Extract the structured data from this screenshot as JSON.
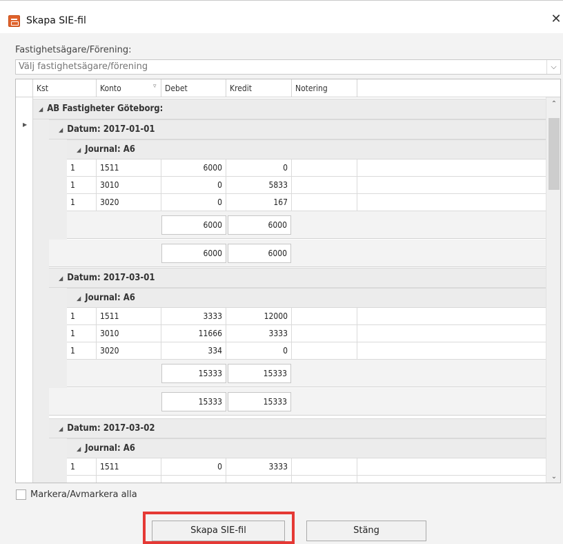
{
  "window": {
    "title": "Skapa SIE-fil",
    "close_glyph": "✕"
  },
  "owner": {
    "label": "Fastighetsägare/Förening:",
    "placeholder": "Välj fastighetsägare/förening",
    "dropdown_glyph": "⌵"
  },
  "grid": {
    "columns": [
      "Kst",
      "Konto",
      "Debet",
      "Kredit",
      "Notering"
    ],
    "group": "AB Fastigheter Göteborg:",
    "dates": [
      {
        "label": "Datum: 2017-01-01",
        "journal": "Journal: A6",
        "rows": [
          [
            "1",
            "1511",
            "6000",
            "0",
            ""
          ],
          [
            "1",
            "3010",
            "0",
            "5833",
            ""
          ],
          [
            "1",
            "3020",
            "0",
            "167",
            ""
          ]
        ],
        "journal_sum": [
          "6000",
          "6000"
        ],
        "date_sum": [
          "6000",
          "6000"
        ]
      },
      {
        "label": "Datum: 2017-03-01",
        "journal": "Journal: A6",
        "rows": [
          [
            "1",
            "1511",
            "3333",
            "12000",
            ""
          ],
          [
            "1",
            "3010",
            "11666",
            "3333",
            ""
          ],
          [
            "1",
            "3020",
            "334",
            "0",
            ""
          ]
        ],
        "journal_sum": [
          "15333",
          "15333"
        ],
        "date_sum": [
          "15333",
          "15333"
        ]
      },
      {
        "label": "Datum: 2017-03-02",
        "journal": "Journal: A6",
        "rows": [
          [
            "1",
            "1511",
            "0",
            "3333",
            ""
          ]
        ]
      }
    ]
  },
  "footer": {
    "select_all": "Markera/Avmarkera alla",
    "create_button": "Skapa SIE-fil",
    "close_button": "Stäng"
  },
  "colors": {
    "highlight": "#e53935",
    "app_icon": "#e0622b"
  }
}
